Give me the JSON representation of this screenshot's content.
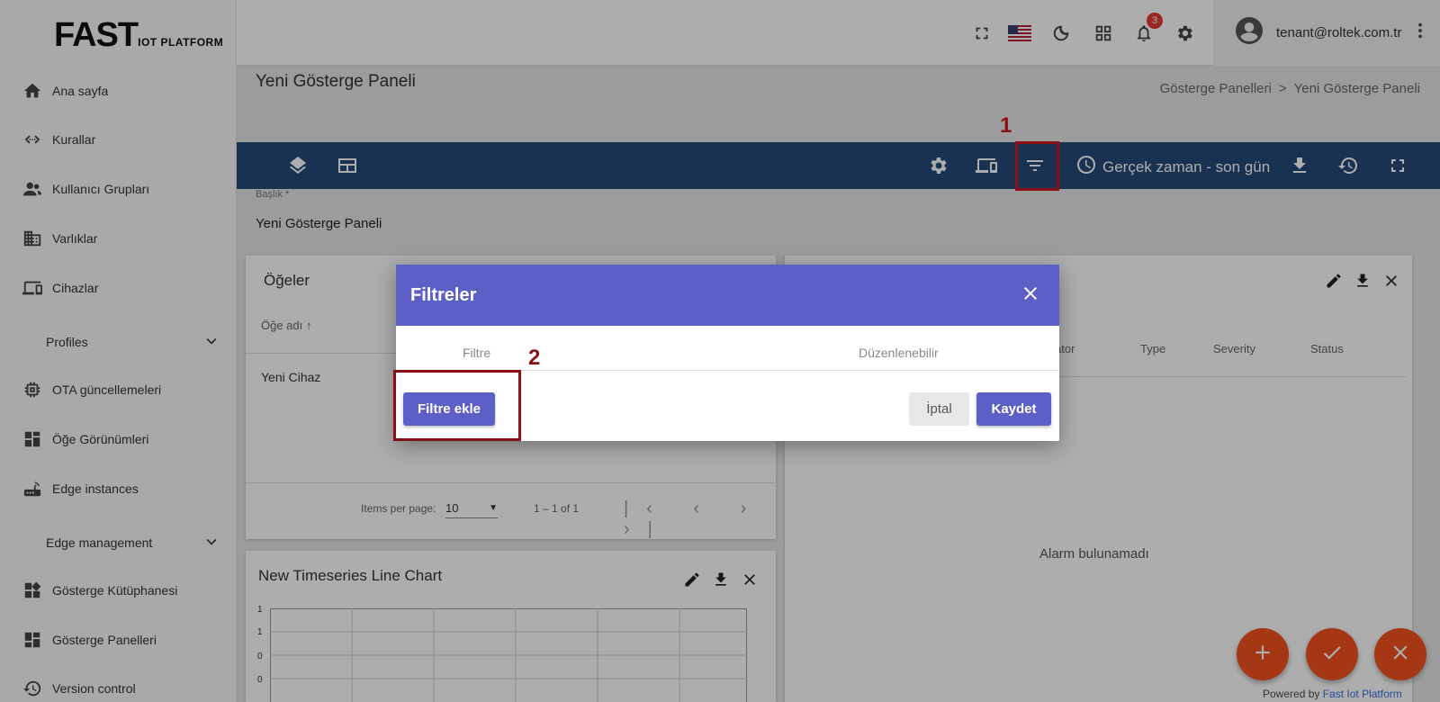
{
  "logo": {
    "big": "FAST",
    "small": "IOT PLATFORM"
  },
  "sidebar": {
    "items": [
      {
        "label": "Ana sayfa",
        "icon": "home-icon"
      },
      {
        "label": "Kurallar",
        "icon": "code-arrows-icon"
      },
      {
        "label": "Kullanıcı Grupları",
        "icon": "users-icon"
      },
      {
        "label": "Varlıklar",
        "icon": "building-icon"
      },
      {
        "label": "Cihazlar",
        "icon": "devices-icon"
      },
      {
        "label": "OTA güncellemeleri",
        "icon": "chip-icon"
      },
      {
        "label": "Öğe Görünümleri",
        "icon": "layout-icon"
      },
      {
        "label": "Edge instances",
        "icon": "router-icon"
      },
      {
        "label": "Gösterge Kütüphanesi",
        "icon": "widgets-icon"
      },
      {
        "label": "Gösterge Panelleri",
        "icon": "dashboard-icon"
      },
      {
        "label": "Version control",
        "icon": "history-icon"
      }
    ],
    "groups": [
      {
        "label": "Profiles"
      },
      {
        "label": "Edge management"
      }
    ]
  },
  "header": {
    "notification_count": "3",
    "user_email": "tenant@roltek.com.tr"
  },
  "page": {
    "title": "Yeni Gösterge Paneli",
    "breadcrumb": [
      "Gösterge Panelleri",
      ">",
      "Yeni Gösterge Paneli"
    ]
  },
  "toolbar": {
    "time_label": "Gerçek zaman - son gün"
  },
  "annotations": {
    "step1": "1",
    "step2": "2"
  },
  "title_field": {
    "label": "Başlık *",
    "value": "Yeni Gösterge Paneli"
  },
  "widget_entities": {
    "title": "Öğeler",
    "column": "Öğe adı",
    "row": "Yeni Cihaz",
    "items_per_page_label": "Items per page:",
    "items_per_page": "10",
    "range": "1 – 1 of 1"
  },
  "widget_alarms": {
    "columns": [
      "ator",
      "Type",
      "Severity",
      "Status"
    ],
    "empty": "Alarm bulunamadı"
  },
  "widget_chart": {
    "title": "New Timeseries Line Chart",
    "ticks": [
      "1",
      "1",
      "0",
      "0"
    ]
  },
  "dialog": {
    "title": "Filtreler",
    "col_filter": "Filtre",
    "col_editable": "Düzenlenebilir",
    "add_button": "Filtre ekle",
    "cancel_button": "İptal",
    "save_button": "Kaydet"
  },
  "footer": {
    "powered_prefix": "Powered by",
    "powered_brand": "Fast Iot Platform"
  },
  "colors": {
    "toolbar": "#264b7a",
    "dialog_header": "#5c60c6",
    "fab": "#f4511e",
    "highlight": "#8b0f17"
  }
}
